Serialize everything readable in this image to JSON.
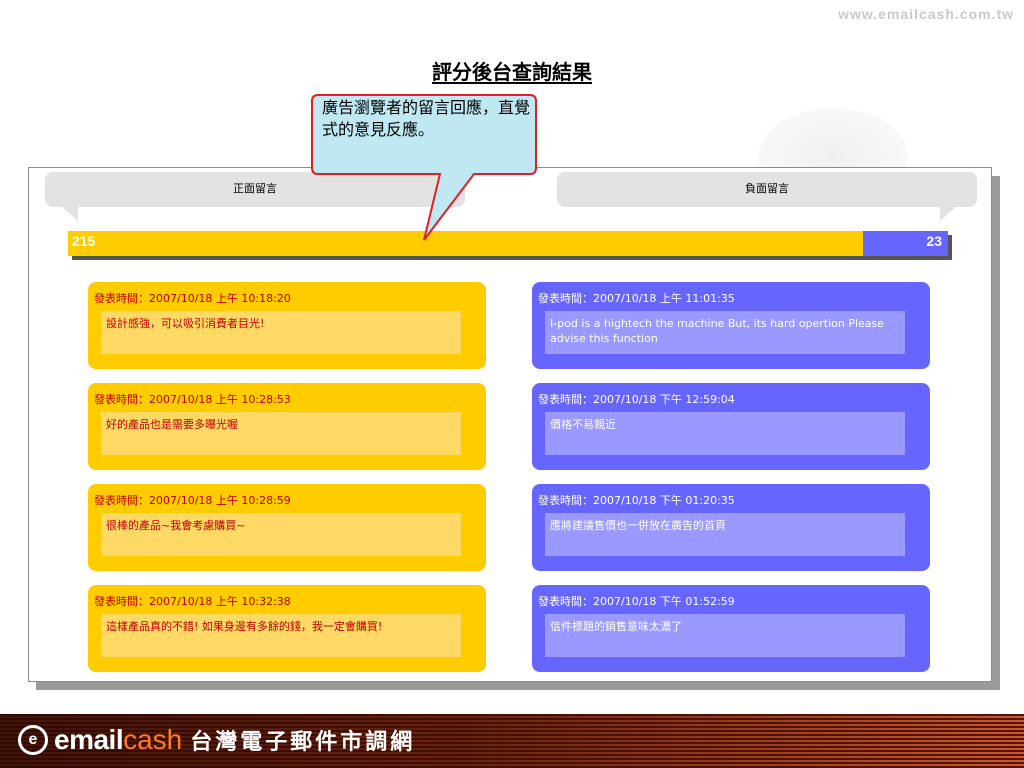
{
  "site_url": "www.emailcash.com.tw",
  "page_title": "評分後台查詢結果",
  "callout": {
    "text": "廣告瀏覽者的留言回應，直覺式的意見反應。"
  },
  "columns": {
    "positive_label": "正面留言",
    "negative_label": "負面留言"
  },
  "summary_bar": {
    "positive_count": "215",
    "negative_count": "23",
    "positive_fraction": 0.903,
    "colors": {
      "positive": "#ffcc00",
      "negative": "#6666ff"
    }
  },
  "positive_comments": [
    {
      "time": "發表時間：2007/10/18 上午 10:18:20",
      "text": "設計感強，可以吸引消費者目光!"
    },
    {
      "time": "發表時間：2007/10/18 上午 10:28:53",
      "text": "好的產品也是需要多曝光喔"
    },
    {
      "time": "發表時間：2007/10/18 上午 10:28:59",
      "text": "很棒的產品~我會考慮購買~"
    },
    {
      "time": "發表時間：2007/10/18 上午 10:32:38",
      "text": "這樣產品真的不錯! 如果身邊有多餘的錢，我一定會購買!"
    }
  ],
  "negative_comments": [
    {
      "time": "發表時間：2007/10/18 上午 11:01:35",
      "text": "I-pod is a hightech the machine But, its hard opertion Please advise this function"
    },
    {
      "time": "發表時間：2007/10/18 下午 12:59:04",
      "text": "價格不易親近"
    },
    {
      "time": "發表時間：2007/10/18 下午 01:20:35",
      "text": "應將建議售價也一併放在廣告的首頁"
    },
    {
      "time": "發表時間：2007/10/18 下午 01:52:59",
      "text": "信件標題的銷售意味太濃了"
    }
  ],
  "footer": {
    "logo_mark": "e",
    "logo_email": "email",
    "logo_cash": "cash",
    "tagline": "台灣電子郵件市調網"
  },
  "icons": {
    "logo": "emailcash-logo-icon"
  }
}
